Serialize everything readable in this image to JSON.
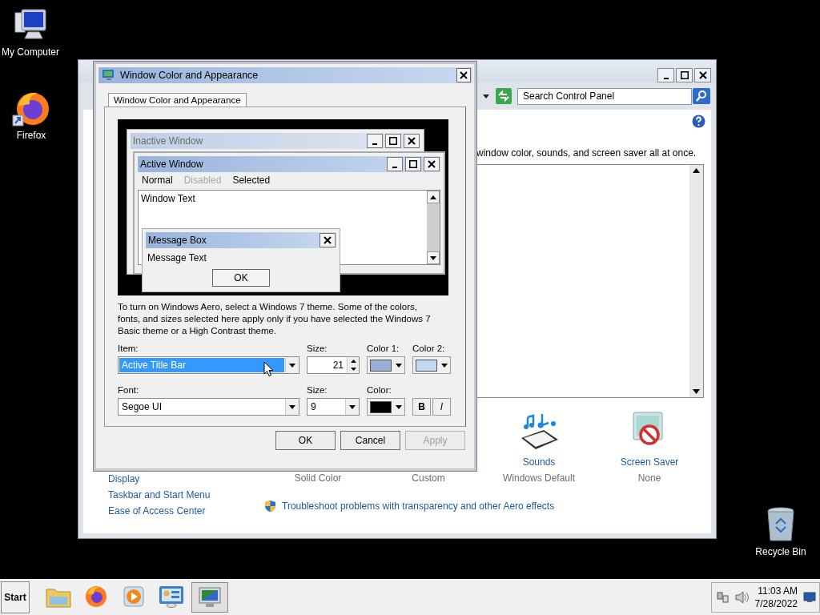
{
  "desktop_icons": [
    {
      "label": "My Computer"
    },
    {
      "label": "Firefox"
    },
    {
      "label": "Recycle Bin"
    }
  ],
  "control_panel": {
    "search": {
      "placeholder": "Search Control Panel"
    },
    "description": "window color, sounds, and screen saver all at once.",
    "items": [
      {
        "subtitle": "Solid Color"
      },
      {
        "subtitle": "Custom"
      },
      {
        "name": "Sounds",
        "subtitle": "Windows Default"
      },
      {
        "name": "Screen Saver",
        "subtitle": "None"
      }
    ],
    "links": [
      "Display",
      "Taskbar and Start Menu",
      "Ease of Access Center"
    ],
    "troubleshoot_link": "Troubleshoot problems with transparency and other Aero effects"
  },
  "dialog": {
    "title": "Window Color and Appearance",
    "tabs": [
      {
        "label": "Window Color and Appearance",
        "selected": true
      }
    ],
    "preview": {
      "inactive_title": "Inactive Window",
      "active_title": "Active Window",
      "menu": [
        {
          "label": "Normal",
          "disabled": false
        },
        {
          "label": "Disabled",
          "disabled": true
        },
        {
          "label": "Selected",
          "disabled": false
        }
      ],
      "window_text": "Window Text",
      "message_title": "Message Box",
      "message_text": "Message Text",
      "message_button": "OK"
    },
    "note": "To turn on Windows Aero, select a Windows 7 theme.  Some of the colors, fonts, and sizes selected here apply only if you have selected the Windows 7 Basic theme or a High Contrast theme.",
    "item": {
      "label": "Item:",
      "value": "Active Title Bar",
      "selected": true
    },
    "size": {
      "label": "Size:",
      "value": "21"
    },
    "color1": {
      "label": "Color 1:",
      "color": "#98b0d4"
    },
    "color2": {
      "label": "Color 2:",
      "color": "#c4d8f4"
    },
    "font": {
      "label": "Font:",
      "value": "Segoe UI"
    },
    "font_size": {
      "label": "Size:",
      "value": "9"
    },
    "font_color": {
      "label": "Color:",
      "color": "#000000"
    },
    "bold": "B",
    "italic": "I",
    "buttons": [
      {
        "label": "OK",
        "disabled": false
      },
      {
        "label": "Cancel",
        "disabled": false
      },
      {
        "label": "Apply",
        "disabled": true
      }
    ]
  },
  "taskbar": {
    "start": "Start",
    "apps": [
      {
        "selected": false
      },
      {
        "selected": false
      },
      {
        "selected": false
      },
      {
        "selected": false
      },
      {
        "selected": true
      }
    ],
    "clock_time": "11:03 AM",
    "clock_date": "7/28/2022"
  }
}
